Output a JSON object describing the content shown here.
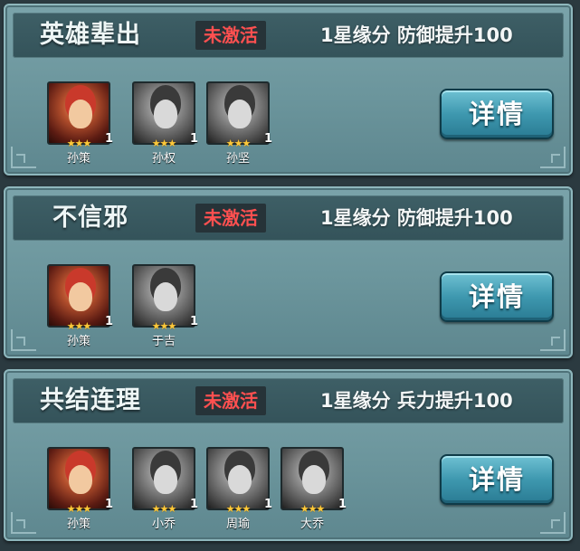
{
  "cards": [
    {
      "title": "英雄辈出",
      "status": "未激活",
      "bonus": "1星缘分 防御提升100",
      "button": "详情",
      "heroes": [
        {
          "name": "孙策",
          "level": "1",
          "stars": "★★★",
          "colored": true
        },
        {
          "name": "孙权",
          "level": "1",
          "stars": "★★★",
          "colored": false
        },
        {
          "name": "孙坚",
          "level": "1",
          "stars": "★★★",
          "colored": false
        }
      ]
    },
    {
      "title": "不信邪",
      "status": "未激活",
      "bonus": "1星缘分 防御提升100",
      "button": "详情",
      "heroes": [
        {
          "name": "孙策",
          "level": "1",
          "stars": "★★★",
          "colored": true
        },
        {
          "name": "于吉",
          "level": "1",
          "stars": "★★★",
          "colored": false
        }
      ]
    },
    {
      "title": "共结连理",
      "status": "未激活",
      "bonus": "1星缘分 兵力提升100",
      "button": "详情",
      "heroes": [
        {
          "name": "孙策",
          "level": "1",
          "stars": "★★★",
          "colored": true
        },
        {
          "name": "小乔",
          "level": "1",
          "stars": "★★★",
          "colored": false
        },
        {
          "name": "周瑜",
          "level": "1",
          "stars": "★★★",
          "colored": false
        },
        {
          "name": "大乔",
          "level": "1",
          "stars": "★★★",
          "colored": false
        }
      ]
    }
  ],
  "colors": {
    "status_inactive": "#ff5050",
    "star": "#ffc93a",
    "button": "#3e98af"
  }
}
